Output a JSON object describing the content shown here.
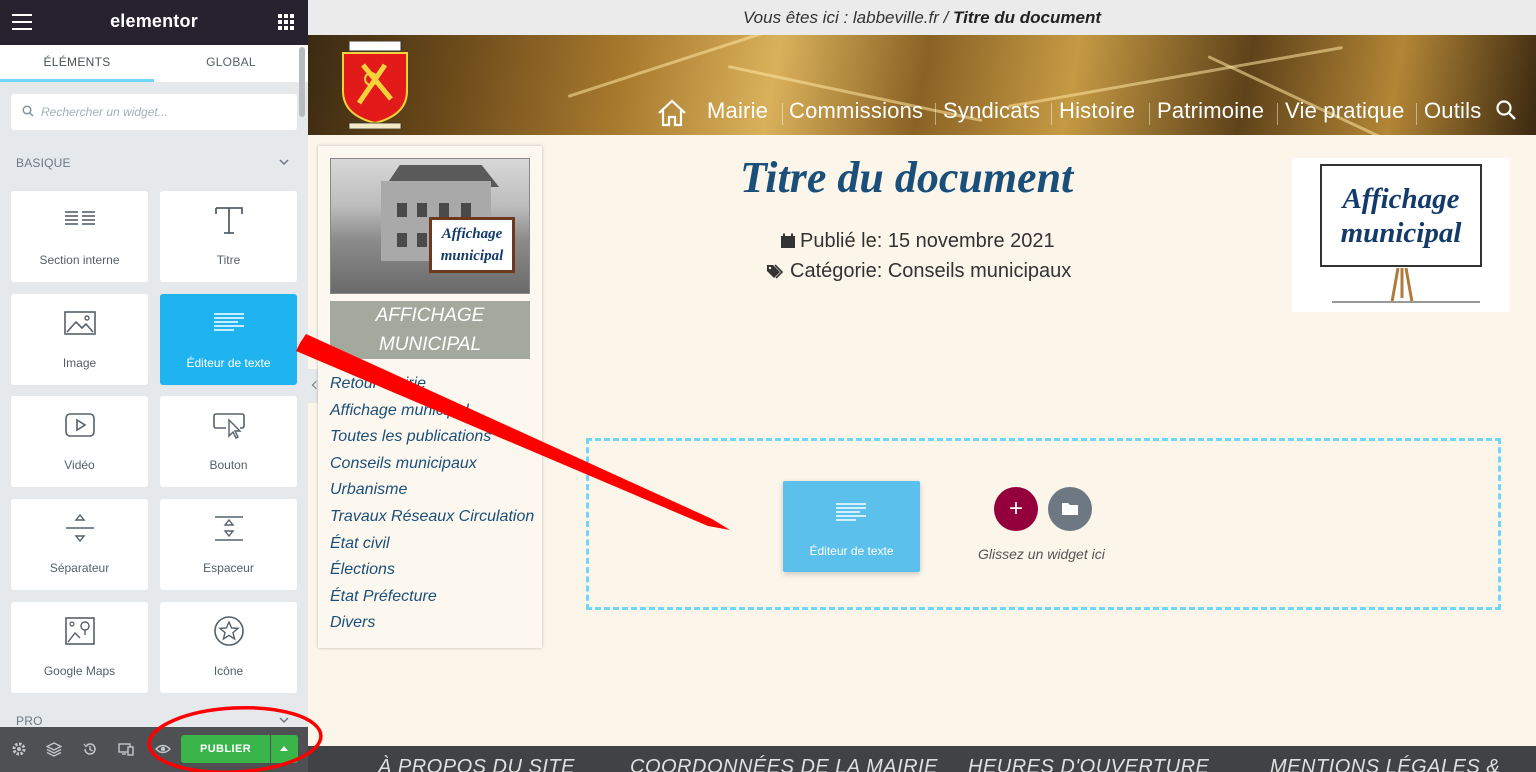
{
  "panel": {
    "brand": "elementor",
    "tabs": [
      {
        "label": "ÉLÉMENTS"
      },
      {
        "label": "GLOBAL"
      }
    ],
    "search": {
      "placeholder": "Rechercher un widget..."
    },
    "categories": [
      {
        "label": "BASIQUE"
      },
      {
        "label": "PRO"
      }
    ],
    "widgets": [
      {
        "label": "Section interne",
        "icon": "inner-section-icon"
      },
      {
        "label": "Titre",
        "icon": "heading-icon"
      },
      {
        "label": "Image",
        "icon": "image-icon"
      },
      {
        "label": "Éditeur de texte",
        "icon": "text-editor-icon",
        "active": true
      },
      {
        "label": "Vidéo",
        "icon": "video-icon"
      },
      {
        "label": "Bouton",
        "icon": "button-icon"
      },
      {
        "label": "Séparateur",
        "icon": "divider-icon"
      },
      {
        "label": "Espaceur",
        "icon": "spacer-icon"
      },
      {
        "label": "Google Maps",
        "icon": "map-icon"
      },
      {
        "label": "Icône",
        "icon": "star-icon"
      }
    ],
    "footer": {
      "icons": [
        "settings-icon",
        "layers-icon",
        "history-icon",
        "responsive-icon",
        "preview-icon"
      ],
      "publish_label": "PUBLIER"
    }
  },
  "preview": {
    "breadcrumb": {
      "prefix": "Vous êtes ici : labbeville.fr / ",
      "current": "Titre du document"
    },
    "nav": [
      "Mairie",
      "Commissions",
      "Syndicats",
      "Histoire",
      "Patrimoine",
      "Vie pratique",
      "Outils"
    ],
    "sidebar": {
      "photo_sign": [
        "Affichage",
        "municipal"
      ],
      "heading_lines": [
        "AFFICHAGE",
        "MUNICIPAL"
      ],
      "links": [
        "Retour Mairie",
        "Affichage municipal",
        "Toutes les publications",
        "Conseils municipaux",
        "Urbanisme",
        "Travaux Réseaux Circulation",
        "État civil",
        "Élections",
        "État Préfecture",
        "Divers"
      ]
    },
    "document": {
      "title": "Titre du document",
      "published": "Publié le: 15 novembre 2021",
      "category": "Catégorie: Conseils municipaux"
    },
    "poster": {
      "lines": [
        "Affichage",
        "municipal"
      ]
    },
    "drop_zone": {
      "dragged_widget": "Éditeur de texte",
      "add_label": "+",
      "hint": "Glissez un widget ici"
    },
    "footer": [
      "À PROPOS DU SITE",
      "COORDONNÉES DE LA MAIRIE",
      "HEURES D'OUVERTURE",
      "MENTIONS LÉGALES &"
    ]
  },
  "colors": {
    "panel_header": "#26222f",
    "accent_blue": "#1fb4ef",
    "publish_green": "#39b54a",
    "annotation_red": "#ff0000",
    "link_blue": "#1a4f7a",
    "add_button": "#93003c"
  }
}
